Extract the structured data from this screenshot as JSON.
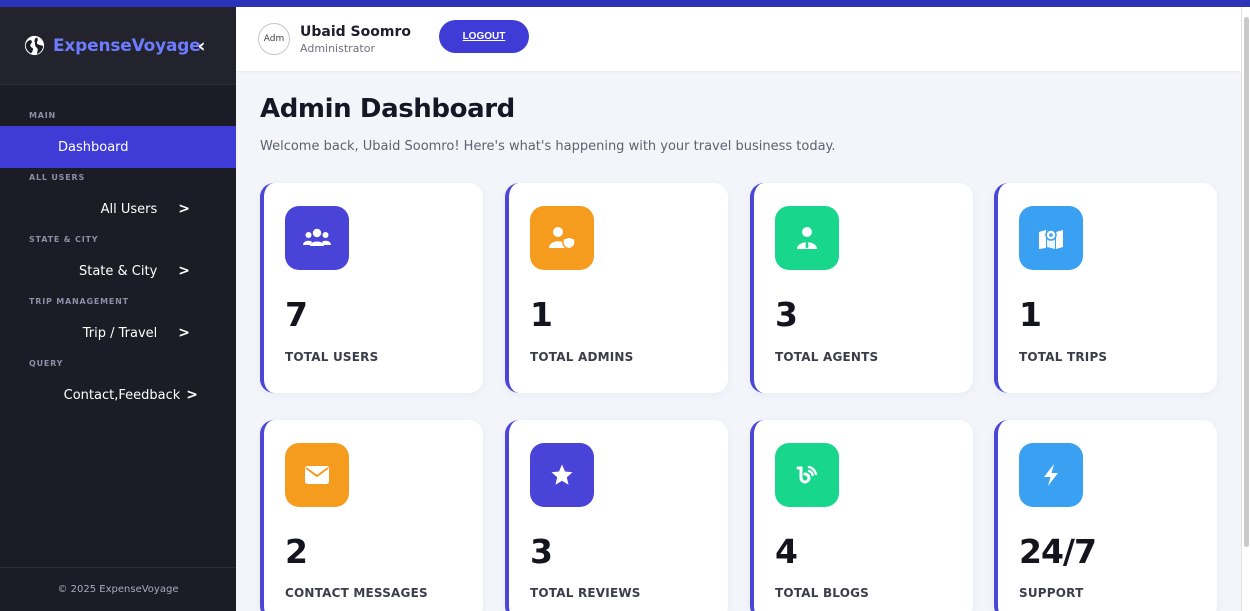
{
  "brand": {
    "name": "ExpenseVoyage",
    "collapse_glyph": "‹"
  },
  "sidebar": {
    "main_label": "MAIN",
    "active_item": "Dashboard",
    "sections": [
      {
        "label": "ALL USERS",
        "item": "All Users"
      },
      {
        "label": "STATE & CITY",
        "item": "State & City"
      },
      {
        "label": "TRIP MANAGEMENT",
        "item": "Trip / Travel"
      },
      {
        "label": "QUERY",
        "item": "Contact,Feedback"
      }
    ],
    "footer": "© 2025 ExpenseVoyage"
  },
  "topbar": {
    "avatar_alt": "Adm",
    "user_name": "Ubaid Soomro",
    "user_role": "Administrator",
    "logout_label": "LOGOUT"
  },
  "page": {
    "title": "Admin Dashboard",
    "subtitle": "Welcome back, Ubaid Soomro! Here's what's happening with your travel business today."
  },
  "cards": [
    {
      "value": "7",
      "label": "TOTAL USERS",
      "icon": "users-icon",
      "color": "#4a43d8"
    },
    {
      "value": "1",
      "label": "TOTAL ADMINS",
      "icon": "admin-shield-icon",
      "color": "#f59b1d"
    },
    {
      "value": "3",
      "label": "TOTAL AGENTS",
      "icon": "agent-icon",
      "color": "#18d68c"
    },
    {
      "value": "1",
      "label": "TOTAL TRIPS",
      "icon": "map-icon",
      "color": "#3aa0f2"
    },
    {
      "value": "2",
      "label": "CONTACT MESSAGES",
      "icon": "envelope-icon",
      "color": "#f59b1d"
    },
    {
      "value": "3",
      "label": "TOTAL REVIEWS",
      "icon": "star-icon",
      "color": "#4a43d8"
    },
    {
      "value": "4",
      "label": "TOTAL BLOGS",
      "icon": "blog-feed-icon",
      "color": "#18d68c"
    },
    {
      "value": "24/7",
      "label": "SUPPORT",
      "icon": "bolt-icon",
      "color": "#3aa0f2"
    }
  ],
  "colors": {
    "accent": "#3f3bd6",
    "sidebar_bg": "#1b1c26",
    "page_bg": "#f3f5fb"
  }
}
